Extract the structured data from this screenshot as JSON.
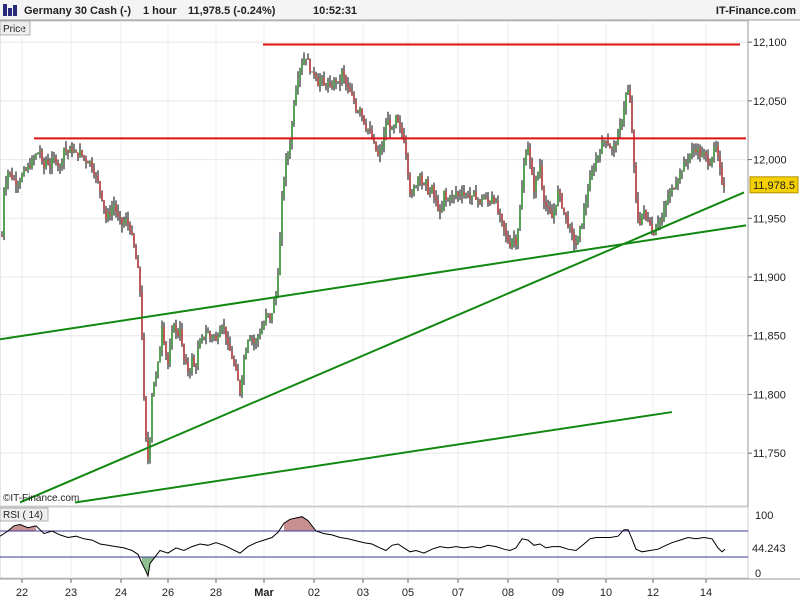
{
  "header": {
    "instrument": "Germany 30 Cash (-)",
    "timeframe": "1 hour",
    "last_change": "11,978.5 (-0.24%)",
    "time": "10:52:31",
    "brand": "IT-Finance.com"
  },
  "price_panel": {
    "label": "Price",
    "watermark": "©IT-Finance.com",
    "current_price_label": "11,978.5"
  },
  "rsi_panel": {
    "label": "RSI ( 14)",
    "current_value_label": "44.243"
  },
  "colors": {
    "up_candle": "#2e8b2e",
    "down_candle": "#b03030",
    "wick": "#000000",
    "resistance": "#dd1111",
    "trendline": "#118811",
    "price_tag": "#f5d000",
    "rsi_line": "#000000",
    "rsi_overbought_fill": "#c89090",
    "rsi_oversold_fill": "#8fbf8f",
    "rsi_band_line": "#3a3a9a"
  },
  "chart_data": [
    {
      "type": "candlestick",
      "title": "Germany 30 Cash (-) 1 hour",
      "ylabel": "Price",
      "ylim": [
        11705,
        12118
      ],
      "y_ticks": [
        11750,
        11800,
        11850,
        11900,
        11950,
        12000,
        12050,
        12100
      ],
      "y_tick_labels": [
        "11,750",
        "11,800",
        "11,850",
        "11,900",
        "11,950",
        "12,000",
        "12,050",
        "12,100"
      ],
      "x_tick_labels": [
        "22",
        "23",
        "24",
        "26",
        "28",
        "Mar",
        "02",
        "03",
        "05",
        "07",
        "08",
        "09",
        "10",
        "12",
        "14"
      ],
      "close_path": [
        [
          0,
          11895
        ],
        [
          4,
          11975
        ],
        [
          8,
          11990
        ],
        [
          12,
          11985
        ],
        [
          17,
          11980
        ],
        [
          22,
          11986
        ],
        [
          27,
          11992
        ],
        [
          32,
          11998
        ],
        [
          37,
          12005
        ],
        [
          40,
          12008
        ],
        [
          43,
          11990
        ],
        [
          46,
          12000
        ],
        [
          50,
          11995
        ],
        [
          55,
          12002
        ],
        [
          60,
          11993
        ],
        [
          64,
          12010
        ],
        [
          68,
          12006
        ],
        [
          72,
          12009
        ],
        [
          76,
          12004
        ],
        [
          80,
          12006
        ],
        [
          85,
          12000
        ],
        [
          90,
          11998
        ],
        [
          94,
          11990
        ],
        [
          98,
          11980
        ],
        [
          102,
          11968
        ],
        [
          106,
          11950
        ],
        [
          110,
          11955
        ],
        [
          114,
          11962
        ],
        [
          118,
          11950
        ],
        [
          122,
          11945
        ],
        [
          126,
          11948
        ],
        [
          130,
          11942
        ],
        [
          134,
          11925
        ],
        [
          138,
          11905
        ],
        [
          141,
          11880
        ],
        [
          143,
          11820
        ],
        [
          145,
          11770
        ],
        [
          147,
          11750
        ],
        [
          149,
          11740
        ],
        [
          151,
          11790
        ],
        [
          153,
          11810
        ],
        [
          156,
          11815
        ],
        [
          159,
          11830
        ],
        [
          162,
          11860
        ],
        [
          165,
          11840
        ],
        [
          168,
          11826
        ],
        [
          171,
          11845
        ],
        [
          174,
          11862
        ],
        [
          177,
          11848
        ],
        [
          180,
          11858
        ],
        [
          183,
          11832
        ],
        [
          186,
          11825
        ],
        [
          189,
          11818
        ],
        [
          192,
          11830
        ],
        [
          195,
          11820
        ],
        [
          198,
          11838
        ],
        [
          201,
          11845
        ],
        [
          204,
          11850
        ],
        [
          207,
          11855
        ],
        [
          210,
          11848
        ],
        [
          213,
          11852
        ],
        [
          216,
          11845
        ],
        [
          219,
          11856
        ],
        [
          222,
          11860
        ],
        [
          225,
          11855
        ],
        [
          228,
          11840
        ],
        [
          231,
          11835
        ],
        [
          234,
          11825
        ],
        [
          237,
          11815
        ],
        [
          240,
          11802
        ],
        [
          243,
          11825
        ],
        [
          246,
          11840
        ],
        [
          249,
          11852
        ],
        [
          252,
          11848
        ],
        [
          255,
          11842
        ],
        [
          258,
          11850
        ],
        [
          261,
          11855
        ],
        [
          264,
          11860
        ],
        [
          267,
          11870
        ],
        [
          270,
          11862
        ],
        [
          273,
          11875
        ],
        [
          276,
          11885
        ],
        [
          279,
          11915
        ],
        [
          282,
          11965
        ],
        [
          285,
          11995
        ],
        [
          288,
          12005
        ],
        [
          291,
          12020
        ],
        [
          294,
          12050
        ],
        [
          297,
          12068
        ],
        [
          300,
          12078
        ],
        [
          303,
          12085
        ],
        [
          306,
          12088
        ],
        [
          309,
          12080
        ],
        [
          312,
          12072
        ],
        [
          315,
          12076
        ],
        [
          318,
          12065
        ],
        [
          321,
          12070
        ],
        [
          324,
          12062
        ],
        [
          327,
          12066
        ],
        [
          330,
          12060
        ],
        [
          333,
          12065
        ],
        [
          336,
          12068
        ],
        [
          339,
          12062
        ],
        [
          342,
          12075
        ],
        [
          345,
          12066
        ],
        [
          348,
          12060
        ],
        [
          351,
          12055
        ],
        [
          354,
          12050
        ],
        [
          357,
          12040
        ],
        [
          360,
          12045
        ],
        [
          363,
          12035
        ],
        [
          366,
          12028
        ],
        [
          369,
          12025
        ],
        [
          372,
          12018
        ],
        [
          375,
          12010
        ],
        [
          378,
          12003
        ],
        [
          381,
          12008
        ],
        [
          384,
          12020
        ],
        [
          387,
          12035
        ],
        [
          390,
          12028
        ],
        [
          393,
          12022
        ],
        [
          396,
          12035
        ],
        [
          399,
          12028
        ],
        [
          402,
          12022
        ],
        [
          405,
          12015
        ],
        [
          408,
          11990
        ],
        [
          411,
          11965
        ],
        [
          414,
          11975
        ],
        [
          417,
          11982
        ],
        [
          420,
          11990
        ],
        [
          423,
          11975
        ],
        [
          426,
          11980
        ],
        [
          429,
          11970
        ],
        [
          432,
          11975
        ],
        [
          435,
          11965
        ],
        [
          438,
          11960
        ],
        [
          441,
          11950
        ],
        [
          444,
          11972
        ],
        [
          447,
          11962
        ],
        [
          450,
          11970
        ],
        [
          453,
          11966
        ],
        [
          456,
          11972
        ],
        [
          459,
          11968
        ],
        [
          462,
          11975
        ],
        [
          465,
          11968
        ],
        [
          468,
          11972
        ],
        [
          471,
          11965
        ],
        [
          474,
          11970
        ],
        [
          477,
          11968
        ],
        [
          480,
          11962
        ],
        [
          483,
          11970
        ],
        [
          486,
          11966
        ],
        [
          489,
          11962
        ],
        [
          492,
          11970
        ],
        [
          495,
          11965
        ],
        [
          498,
          11955
        ],
        [
          501,
          11948
        ],
        [
          504,
          11940
        ],
        [
          507,
          11932
        ],
        [
          510,
          11928
        ],
        [
          513,
          11935
        ],
        [
          516,
          11930
        ],
        [
          519,
          11948
        ],
        [
          522,
          11975
        ],
        [
          525,
          12005
        ],
        [
          528,
          12012
        ],
        [
          531,
          11990
        ],
        [
          534,
          11975
        ],
        [
          537,
          11985
        ],
        [
          540,
          11995
        ],
        [
          543,
          11970
        ],
        [
          546,
          11960
        ],
        [
          549,
          11955
        ],
        [
          552,
          11950
        ],
        [
          555,
          11960
        ],
        [
          558,
          11972
        ],
        [
          561,
          11965
        ],
        [
          564,
          11955
        ],
        [
          567,
          11948
        ],
        [
          570,
          11940
        ],
        [
          573,
          11932
        ],
        [
          576,
          11928
        ],
        [
          579,
          11935
        ],
        [
          582,
          11948
        ],
        [
          585,
          11960
        ],
        [
          588,
          11975
        ],
        [
          591,
          11985
        ],
        [
          594,
          11995
        ],
        [
          597,
          12002
        ],
        [
          600,
          12008
        ],
        [
          603,
          12015
        ],
        [
          606,
          12018
        ],
        [
          609,
          12012
        ],
        [
          612,
          12008
        ],
        [
          615,
          12012
        ],
        [
          618,
          12020
        ],
        [
          621,
          12030
        ],
        [
          624,
          12045
        ],
        [
          627,
          12060
        ],
        [
          629,
          12055
        ],
        [
          631,
          12040
        ],
        [
          633,
          12010
        ],
        [
          635,
          11975
        ],
        [
          637,
          11955
        ],
        [
          639,
          11945
        ],
        [
          641,
          11950
        ],
        [
          643,
          11958
        ],
        [
          645,
          11952
        ],
        [
          647,
          11946
        ],
        [
          649,
          11955
        ],
        [
          651,
          11940
        ],
        [
          653,
          11935
        ],
        [
          656,
          11945
        ],
        [
          659,
          11950
        ],
        [
          662,
          11948
        ],
        [
          665,
          11960
        ],
        [
          668,
          11968
        ],
        [
          671,
          11972
        ],
        [
          674,
          11978
        ],
        [
          677,
          11984
        ],
        [
          680,
          11988
        ],
        [
          683,
          11994
        ],
        [
          686,
          11998
        ],
        [
          689,
          12004
        ],
        [
          692,
          12006
        ],
        [
          695,
          12010
        ],
        [
          698,
          12008
        ],
        [
          701,
          12002
        ],
        [
          704,
          12005
        ],
        [
          707,
          12000
        ],
        [
          710,
          11998
        ],
        [
          713,
          12006
        ],
        [
          716,
          12010
        ],
        [
          719,
          11995
        ],
        [
          722,
          11982
        ],
        [
          725,
          11978.5
        ]
      ],
      "horizontal_lines": [
        {
          "name": "Resistance 12,100",
          "value": 12098,
          "x_from": 263,
          "x_to": 740
        },
        {
          "name": "Resistance 12,018",
          "value": 12018,
          "x_from": 34,
          "x_to": 746
        }
      ],
      "trend_lines": [
        {
          "x1": 0,
          "y1": 11847,
          "x2": 746,
          "y2": 11944
        },
        {
          "x1": 20,
          "y1": 11708,
          "x2": 744,
          "y2": 11972
        },
        {
          "x1": 75,
          "y1": 11708,
          "x2": 672,
          "y2": 11785
        }
      ],
      "current_price": 11978.5
    },
    {
      "type": "line",
      "title": "RSI ( 14)",
      "ylim": [
        0,
        100
      ],
      "y_tick_labels": [
        "100",
        "0"
      ],
      "levels": [
        70,
        30
      ],
      "values": [
        [
          0,
          62
        ],
        [
          8,
          70
        ],
        [
          14,
          78
        ],
        [
          20,
          80
        ],
        [
          28,
          75
        ],
        [
          36,
          78
        ],
        [
          44,
          66
        ],
        [
          52,
          70
        ],
        [
          60,
          64
        ],
        [
          68,
          60
        ],
        [
          76,
          62
        ],
        [
          84,
          58
        ],
        [
          92,
          56
        ],
        [
          100,
          50
        ],
        [
          108,
          48
        ],
        [
          116,
          46
        ],
        [
          124,
          44
        ],
        [
          132,
          40
        ],
        [
          138,
          34
        ],
        [
          142,
          20
        ],
        [
          146,
          8
        ],
        [
          148,
          0
        ],
        [
          150,
          20
        ],
        [
          154,
          28
        ],
        [
          160,
          40
        ],
        [
          168,
          36
        ],
        [
          176,
          44
        ],
        [
          184,
          40
        ],
        [
          192,
          46
        ],
        [
          200,
          50
        ],
        [
          208,
          48
        ],
        [
          216,
          52
        ],
        [
          224,
          48
        ],
        [
          232,
          42
        ],
        [
          240,
          36
        ],
        [
          248,
          46
        ],
        [
          256,
          52
        ],
        [
          264,
          56
        ],
        [
          272,
          60
        ],
        [
          278,
          68
        ],
        [
          284,
          82
        ],
        [
          290,
          88
        ],
        [
          296,
          90
        ],
        [
          302,
          92
        ],
        [
          308,
          86
        ],
        [
          316,
          70
        ],
        [
          324,
          66
        ],
        [
          332,
          64
        ],
        [
          340,
          60
        ],
        [
          348,
          58
        ],
        [
          356,
          55
        ],
        [
          364,
          52
        ],
        [
          372,
          50
        ],
        [
          380,
          44
        ],
        [
          386,
          40
        ],
        [
          392,
          48
        ],
        [
          398,
          50
        ],
        [
          404,
          44
        ],
        [
          410,
          38
        ],
        [
          416,
          40
        ],
        [
          424,
          36
        ],
        [
          432,
          42
        ],
        [
          440,
          46
        ],
        [
          448,
          44
        ],
        [
          456,
          46
        ],
        [
          464,
          44
        ],
        [
          472,
          46
        ],
        [
          480,
          44
        ],
        [
          488,
          48
        ],
        [
          496,
          46
        ],
        [
          504,
          42
        ],
        [
          510,
          40
        ],
        [
          516,
          44
        ],
        [
          522,
          58
        ],
        [
          528,
          56
        ],
        [
          534,
          48
        ],
        [
          540,
          50
        ],
        [
          546,
          44
        ],
        [
          552,
          46
        ],
        [
          560,
          46
        ],
        [
          568,
          42
        ],
        [
          576,
          40
        ],
        [
          584,
          50
        ],
        [
          590,
          58
        ],
        [
          596,
          60
        ],
        [
          602,
          60
        ],
        [
          610,
          60
        ],
        [
          618,
          62
        ],
        [
          624,
          72
        ],
        [
          628,
          72
        ],
        [
          632,
          58
        ],
        [
          636,
          42
        ],
        [
          642,
          38
        ],
        [
          650,
          40
        ],
        [
          658,
          42
        ],
        [
          666,
          48
        ],
        [
          672,
          52
        ],
        [
          680,
          56
        ],
        [
          688,
          60
        ],
        [
          696,
          58
        ],
        [
          704,
          60
        ],
        [
          712,
          58
        ],
        [
          718,
          44
        ],
        [
          722,
          38
        ],
        [
          725,
          42
        ]
      ],
      "current_value": 44.243
    }
  ]
}
